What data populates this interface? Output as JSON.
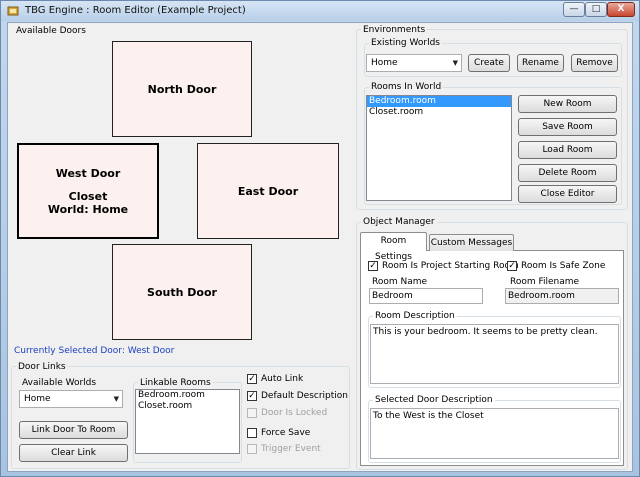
{
  "window": {
    "title": "TBG Engine : Room Editor (Example Project)",
    "minimize_label": "—",
    "maximize_label": "□",
    "close_label": "X"
  },
  "doors": {
    "group_label": "Available Doors",
    "north": {
      "title": "North Door"
    },
    "west": {
      "title": "West Door",
      "room": "Closet",
      "world": "World: Home"
    },
    "east": {
      "title": "East Door"
    },
    "south": {
      "title": "South Door"
    },
    "currently_selected": "Currently Selected Door: West Door"
  },
  "door_links": {
    "group_label": "Door Links",
    "available_worlds_label": "Available Worlds",
    "world_selected": "Home",
    "link_button": "Link Door To Room",
    "clear_button": "Clear Link",
    "linkable_rooms_label": "Linkable Rooms",
    "linkable_rooms": [
      "Bedroom.room",
      "Closet.room"
    ],
    "checks": [
      {
        "label": "Auto Link",
        "checked": true,
        "disabled": false
      },
      {
        "label": "Default Description",
        "checked": true,
        "disabled": false
      },
      {
        "label": "Door Is Locked",
        "checked": false,
        "disabled": true
      },
      {
        "label": "Force Save",
        "checked": false,
        "disabled": false
      },
      {
        "label": "Trigger Event",
        "checked": false,
        "disabled": true
      }
    ]
  },
  "environments": {
    "group_label": "Environments",
    "existing_worlds_label": "Existing Worlds",
    "world_selected": "Home",
    "create_button": "Create",
    "rename_button": "Rename",
    "remove_button": "Remove",
    "rooms_label": "Rooms In World",
    "rooms": [
      "Bedroom.room",
      "Closet.room"
    ],
    "selected_room_index": 0,
    "buttons": {
      "new_room": "New Room",
      "save_room": "Save Room",
      "load_room": "Load Room",
      "delete_room": "Delete Room",
      "close_editor": "Close Editor"
    }
  },
  "object_manager": {
    "group_label": "Object Manager",
    "tabs": [
      {
        "label": "Room Settings",
        "active": true
      },
      {
        "label": "Custom Messages",
        "active": false
      }
    ],
    "starting_room_label": "Room Is Project Starting Room",
    "starting_room_checked": true,
    "safe_zone_label": "Room Is Safe Zone",
    "safe_zone_checked": true,
    "room_name_label": "Room Name",
    "room_name_value": "Bedroom",
    "room_filename_label": "Room Filename",
    "room_filename_value": "Bedroom.room",
    "room_description_label": "Room Description",
    "room_description_value": "This is your bedroom. It seems to be pretty clean.",
    "door_description_label": "Selected Door Description",
    "door_description_value": "To the West is the Closet"
  },
  "colors": {
    "selection": "#3399ff",
    "door_fill": "#fcf1ee",
    "link_text": "#1b3fbf"
  }
}
